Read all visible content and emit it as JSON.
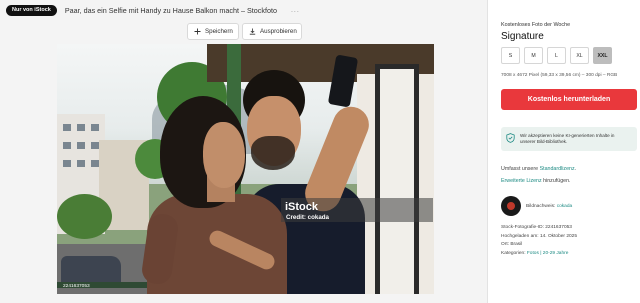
{
  "header": {
    "badge": "Nur von iStock",
    "title": "Paar, das ein Selfie mit Handy zu Hause Balkon macht – Stockfoto",
    "more": "..."
  },
  "actions": {
    "save_label": "Speichern",
    "try_label": "Ausprobieren"
  },
  "photo": {
    "watermark_logo": "iStock",
    "watermark_credit": "Credit: cokada",
    "id_text": "2241637053"
  },
  "panel": {
    "free_label": "Kostenloses Foto der Woche",
    "license_name": "Signature",
    "sizes": [
      "S",
      "M",
      "L",
      "XL",
      "XXL"
    ],
    "selected_size": "XXL",
    "dimensions": "7008 x 4672 Pixel (59,33 x 39,56 cm) – 300 dpi – RGB",
    "download_label": "Kostenlos herunterladen",
    "ai_notice_line1": "Wir akzeptieren keine KI-generierten Inhalte in",
    "ai_notice_line2": "unserer Bild-Bibliothek.",
    "license_prefix": "Umfasst unsere ",
    "license_link": "Standardlizenz",
    "license_suffix": ".",
    "ext_link": "Erweiterte Lizenz",
    "ext_suffix": " hinzufügen.",
    "contributor_label": "Bildnachweis:",
    "contributor_name": "cokada",
    "meta_id_label": "Stock-Fotografie-ID: ",
    "meta_id_value": "2241637053",
    "meta_date_label": "Hochgeladen am: ",
    "meta_date_value": "14. Oktober 2025",
    "meta_place_label": "Ort: ",
    "meta_place_value": "Brasil",
    "meta_cat_label": "Kategorien: ",
    "meta_cat_value": "Fotos | 20-29 Jahre"
  },
  "colors": {
    "accent_red": "#e9383c",
    "link_teal": "#1c8a83",
    "badge_black": "#111111"
  }
}
